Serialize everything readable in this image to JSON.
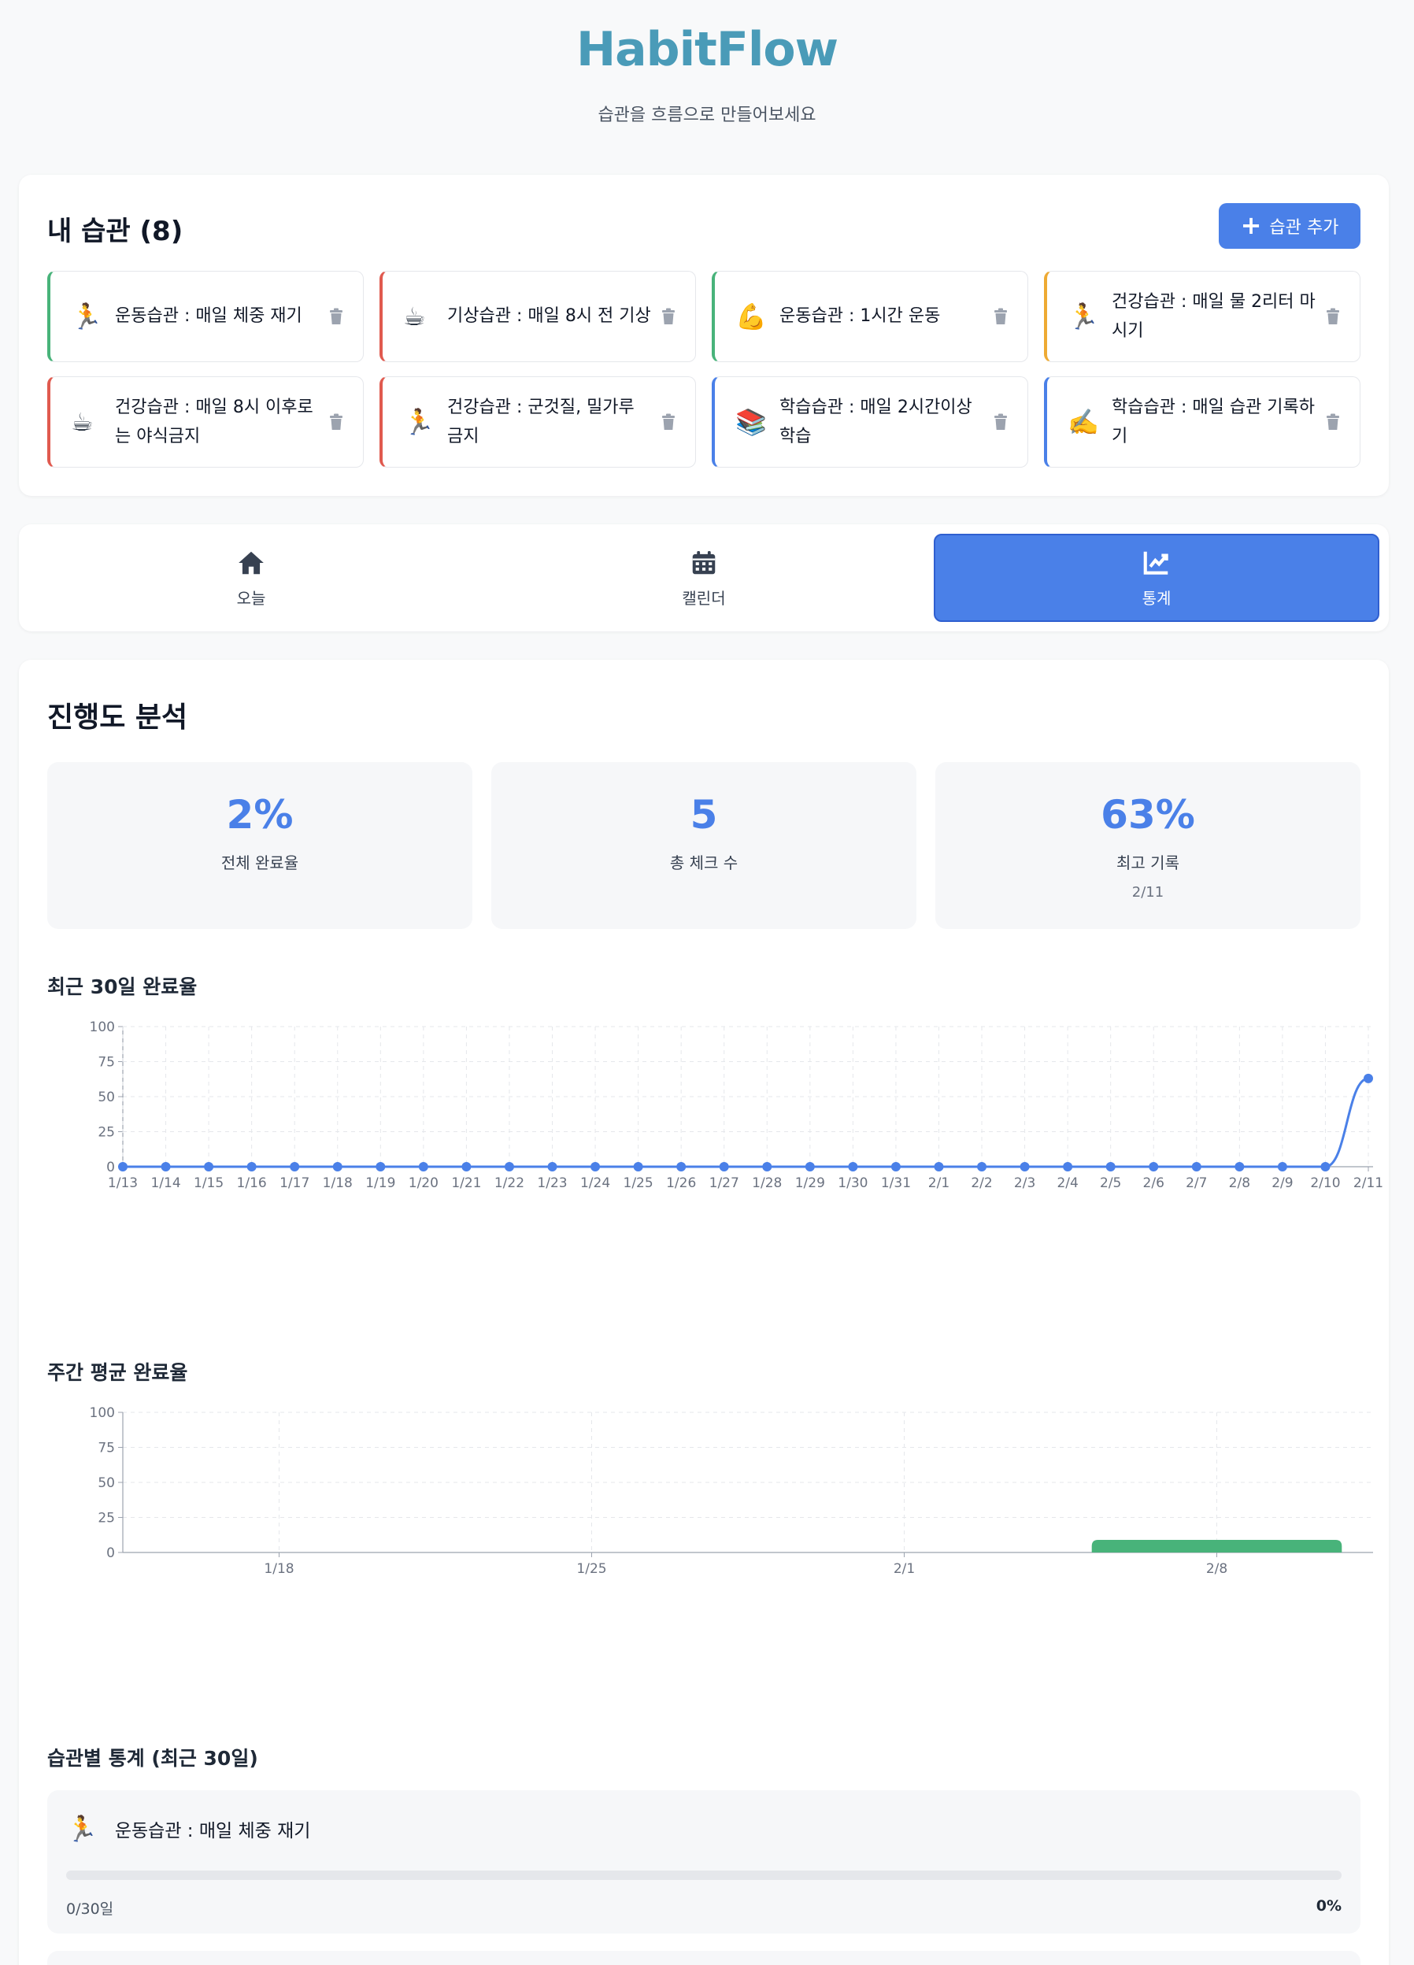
{
  "app": {
    "title": "HabitFlow",
    "subtitle": "습관을 흐름으로 만들어보세요"
  },
  "habits_section": {
    "title": "내 습관 (8)",
    "add_label": "습관 추가",
    "items": [
      {
        "emoji": "🏃",
        "name": "운동습관 : 매일 체중 재기",
        "color": "#48b37a"
      },
      {
        "emoji": "☕",
        "name": "기상습관 : 매일 8시 전 기상",
        "color": "#e05a4f"
      },
      {
        "emoji": "💪",
        "name": "운동습관 : 1시간 운동",
        "color": "#48b37a"
      },
      {
        "emoji": "🏃",
        "name": "건강습관 : 매일 물 2리터 마시기",
        "color": "#eeaa33"
      },
      {
        "emoji": "☕",
        "name": "건강습관 : 매일 8시 이후로는 야식금지",
        "color": "#e05a4f"
      },
      {
        "emoji": "🏃",
        "name": "건강습관 : 군것질, 밀가루 금지",
        "color": "#e05a4f"
      },
      {
        "emoji": "📚",
        "name": "학습습관 : 매일 2시간이상 학습",
        "color": "#4a80e8"
      },
      {
        "emoji": "✍️",
        "name": "학습습관 : 매일 습관 기록하기",
        "color": "#4a80e8"
      }
    ]
  },
  "tabs": [
    {
      "label": "오늘",
      "icon": "home-icon",
      "active": false
    },
    {
      "label": "캘린더",
      "icon": "calendar-icon",
      "active": false
    },
    {
      "label": "통계",
      "icon": "chart-icon",
      "active": true
    }
  ],
  "stats": {
    "title": "진행도 분석",
    "metrics": [
      {
        "value": "2%",
        "label": "전체 완료율",
        "sub": ""
      },
      {
        "value": "5",
        "label": "총 체크 수",
        "sub": ""
      },
      {
        "value": "63%",
        "label": "최고 기록",
        "sub": "2/11"
      }
    ],
    "habit_section_title": "습관별 통계 (최근 30일)",
    "habit_stats": [
      {
        "emoji": "🏃",
        "name": "운동습관 : 매일 체중 재기",
        "days": "0/30일",
        "percent": "0%",
        "fraction": 0
      }
    ]
  },
  "chart_data": [
    {
      "type": "line",
      "title": "최근 30일 완료율",
      "categories": [
        "1/13",
        "1/14",
        "1/15",
        "1/16",
        "1/17",
        "1/18",
        "1/19",
        "1/20",
        "1/21",
        "1/22",
        "1/23",
        "1/24",
        "1/25",
        "1/26",
        "1/27",
        "1/28",
        "1/29",
        "1/30",
        "1/31",
        "2/1",
        "2/2",
        "2/3",
        "2/4",
        "2/5",
        "2/6",
        "2/7",
        "2/8",
        "2/9",
        "2/10",
        "2/11"
      ],
      "values": [
        0,
        0,
        0,
        0,
        0,
        0,
        0,
        0,
        0,
        0,
        0,
        0,
        0,
        0,
        0,
        0,
        0,
        0,
        0,
        0,
        0,
        0,
        0,
        0,
        0,
        0,
        0,
        0,
        0,
        63
      ],
      "yticks": [
        0,
        25,
        50,
        75,
        100
      ],
      "ylim": [
        0,
        100
      ],
      "grid": true,
      "color": "#4a80e8"
    },
    {
      "type": "bar",
      "title": "주간 평균 완료율",
      "categories": [
        "1/18",
        "1/25",
        "2/1",
        "2/8"
      ],
      "values": [
        0,
        0,
        0,
        9
      ],
      "yticks": [
        0,
        25,
        50,
        75,
        100
      ],
      "ylim": [
        0,
        100
      ],
      "grid": true,
      "color": "#48b37a"
    }
  ]
}
